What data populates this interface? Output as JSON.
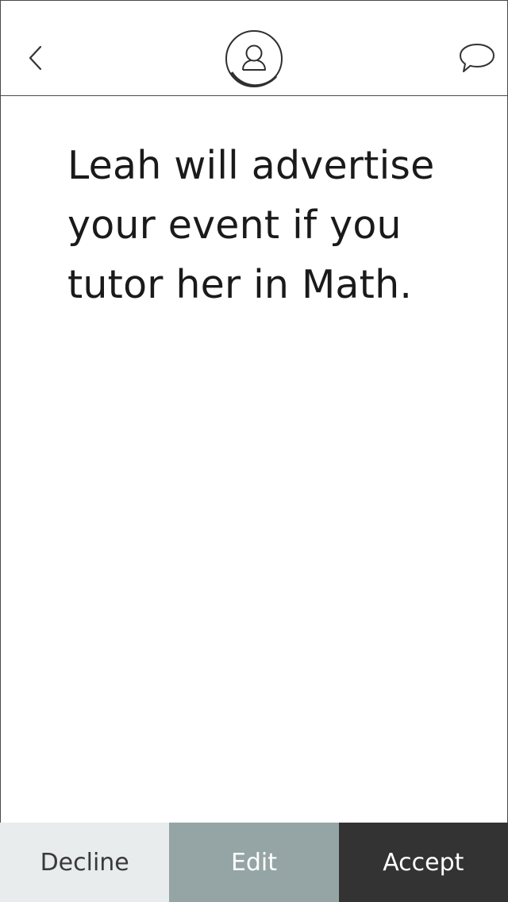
{
  "header": {
    "back_icon": "chevron-left-icon",
    "avatar_icon": "user-icon",
    "chat_icon": "speech-bubble-icon"
  },
  "message": {
    "text": "Leah will advertise your event if you tutor her in Math."
  },
  "actions": {
    "decline_label": "Decline",
    "edit_label": "Edit",
    "accept_label": "Accept"
  },
  "colors": {
    "decline_bg": "#e9ecec",
    "edit_bg": "#95a5a6",
    "accept_bg": "#333333",
    "border": "#4a4a4a"
  }
}
